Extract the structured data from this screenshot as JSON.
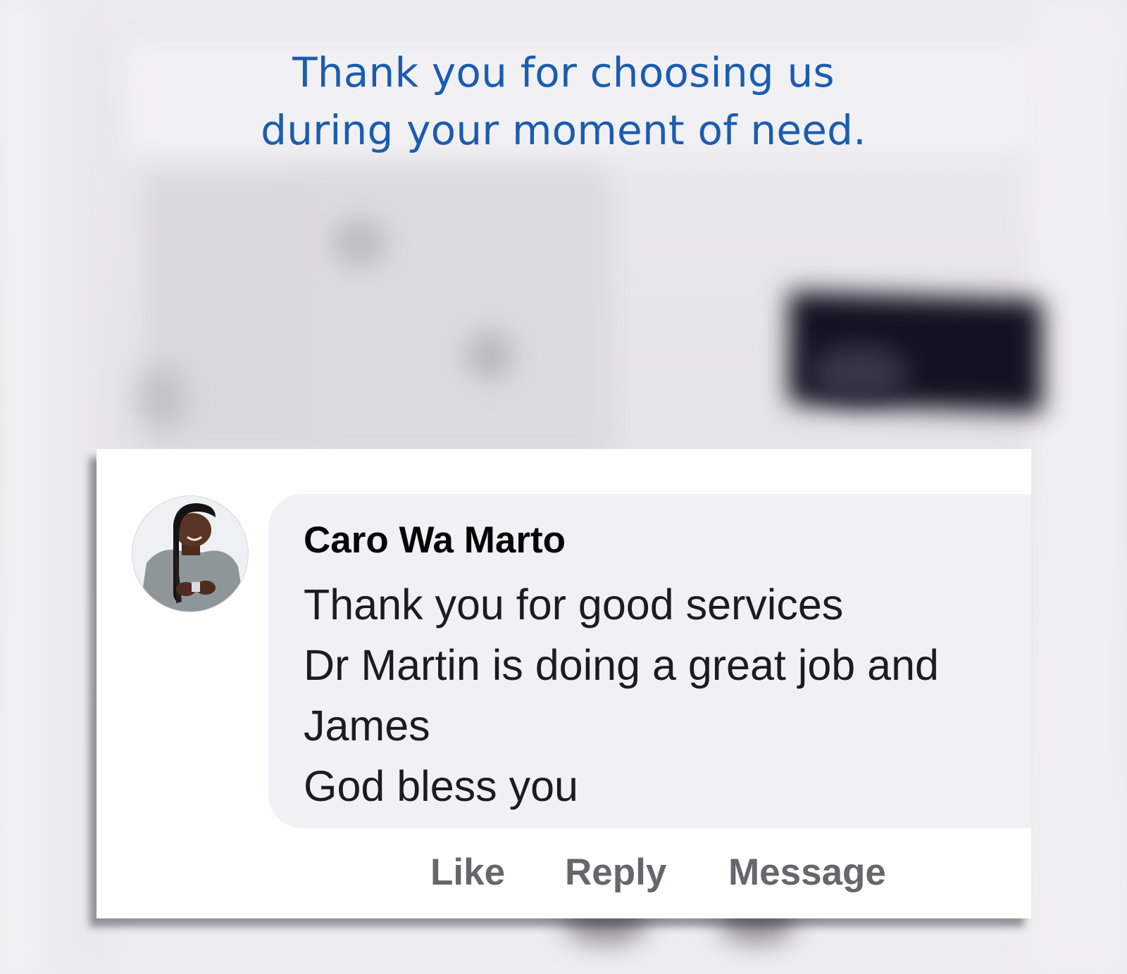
{
  "headline": {
    "line1": "Thank you for choosing us",
    "line2": "during your moment of need.",
    "color": "#1a5cb0"
  },
  "comment": {
    "author": "Caro Wa Marto",
    "avatar_icon": "profile-photo-avatar",
    "lines": [
      "Thank you for good services",
      "Dr Martin is doing a great job and",
      "James",
      "God bless you"
    ],
    "actions": {
      "like": "Like",
      "reply": "Reply",
      "message": "Message"
    }
  }
}
